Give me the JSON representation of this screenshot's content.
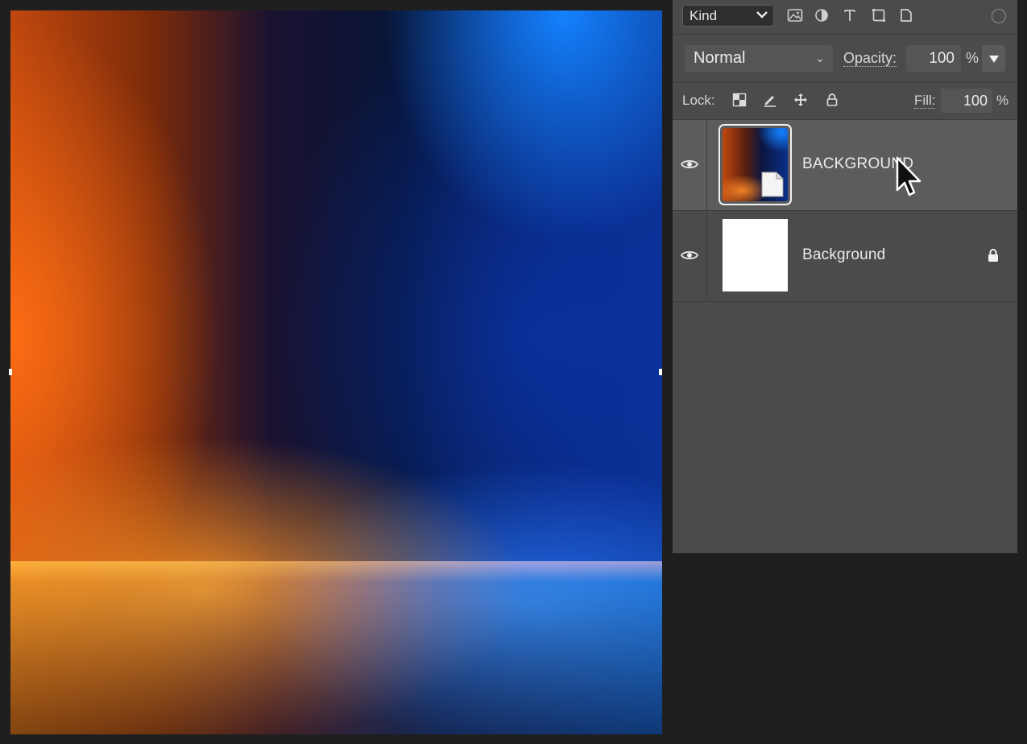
{
  "filter_bar": {
    "kind_label": "Kind",
    "icons": [
      "image-filter-icon",
      "adjustment-filter-icon",
      "type-filter-icon",
      "shape-filter-icon",
      "smart-object-filter-icon"
    ],
    "toggle": "filter-toggle-icon"
  },
  "blend": {
    "mode": "Normal",
    "opacity_label": "Opacity:",
    "opacity_value": "100",
    "percent": "%"
  },
  "lock": {
    "label": "Lock:",
    "icons": [
      "lock-transparent-pixels-icon",
      "lock-image-pixels-icon",
      "lock-position-icon",
      "lock-all-icon"
    ],
    "fill_label": "Fill:",
    "fill_value": "100",
    "percent": "%"
  },
  "layers": [
    {
      "name": "BACKGROUND",
      "selected": true,
      "visible": true,
      "type": "smart-object",
      "locked": false
    },
    {
      "name": "Background",
      "selected": false,
      "visible": true,
      "type": "background",
      "locked": true
    }
  ],
  "colors": {
    "panel_bg": "#4b4b4b",
    "selected_row": "#5c5c5c",
    "workspace_bg": "#1f1f1f"
  }
}
